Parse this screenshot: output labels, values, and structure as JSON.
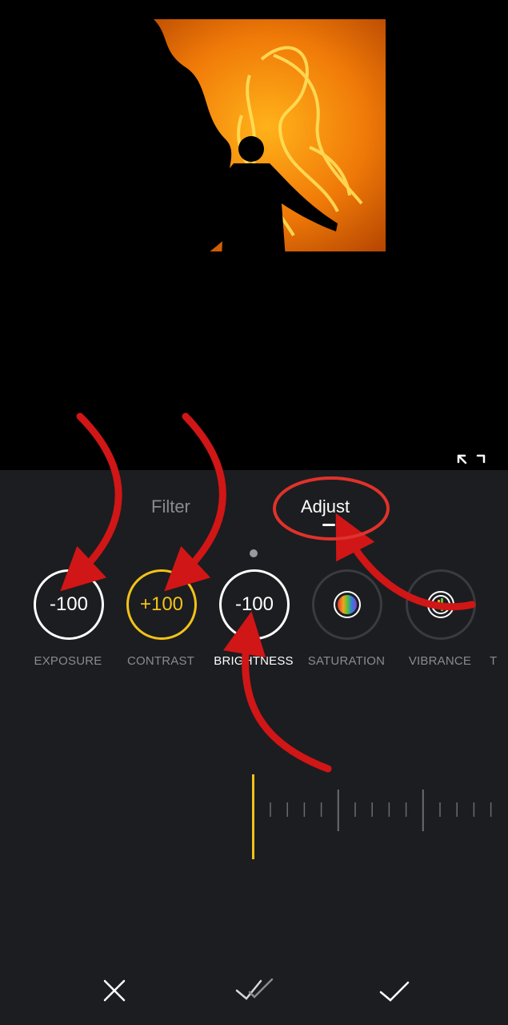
{
  "tabs": [
    {
      "label": "Filter",
      "active": false
    },
    {
      "label": "Adjust",
      "active": true
    }
  ],
  "tools": [
    {
      "name": "EXPOSURE",
      "value": "-100",
      "active": false
    },
    {
      "name": "CONTRAST",
      "value": "+100",
      "active": false,
      "accent": "#f2c318"
    },
    {
      "name": "BRIGHTNESS",
      "value": "-100",
      "active": true
    },
    {
      "name": "SATURATION",
      "icon": "color-wheel-icon"
    },
    {
      "name": "VIBRANCE",
      "icon": "vibrance-icon"
    }
  ],
  "next_tool_label": "T",
  "slider": {
    "value_position": 0,
    "indicator_color": "#f2c318"
  },
  "bottom_bar": {
    "cancel_icon": "close-icon",
    "apply_all_icon": "double-check-icon",
    "confirm_icon": "check-icon"
  },
  "annotation_color": "#e0322b",
  "theme": {
    "panel_bg": "#1c1d20",
    "accent": "#f2c318",
    "muted_text": "#8a8b8f"
  }
}
